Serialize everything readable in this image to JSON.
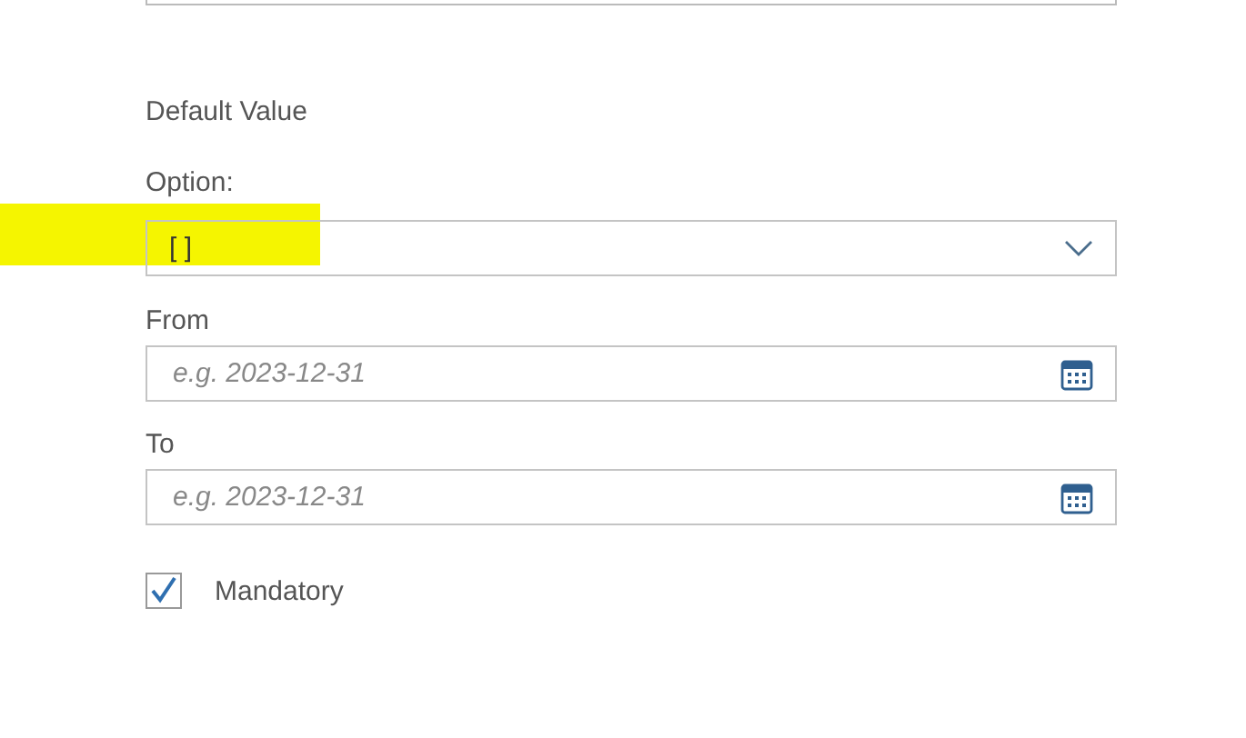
{
  "section_title": "Default Value",
  "option": {
    "label": "Option:",
    "value": "[ ]",
    "highlighted": true
  },
  "date_fields": [
    {
      "label": "From",
      "placeholder": "e.g. 2023-12-31"
    },
    {
      "label": "To",
      "placeholder": "e.g. 2023-12-31"
    }
  ],
  "mandatory": {
    "label": "Mandatory",
    "checked": true
  }
}
